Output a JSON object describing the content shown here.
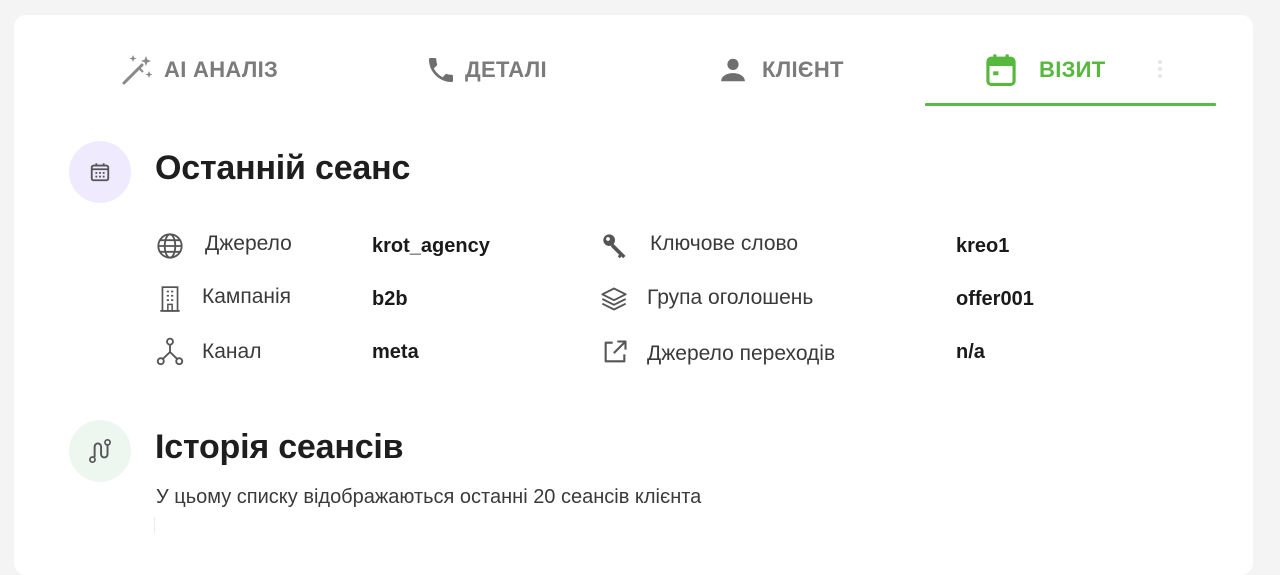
{
  "tabs": [
    {
      "label": "AI АНАЛІЗ",
      "icon": "magic-wand-icon",
      "active": false
    },
    {
      "label": "ДЕТАЛІ",
      "icon": "phone-icon",
      "active": false
    },
    {
      "label": "КЛІЄНТ",
      "icon": "person-icon",
      "active": false
    },
    {
      "label": "ВІЗИТ",
      "icon": "calendar-icon",
      "active": true
    }
  ],
  "colors": {
    "accent": "#56b83c",
    "tab_inactive": "#7b7b7b",
    "last_session_icon_bg": "#efeafd",
    "history_icon_bg": "#eef7ef"
  },
  "last_session": {
    "title": "Останній сеанс",
    "icon": "calendar-icon",
    "fields": {
      "source": {
        "label": "Джерело",
        "value": "krot_agency",
        "icon": "globe-icon"
      },
      "campaign": {
        "label": "Кампанія",
        "value": "b2b",
        "icon": "building-icon"
      },
      "channel": {
        "label": "Канал",
        "value": "meta",
        "icon": "network-icon"
      },
      "keyword": {
        "label": "Ключове слово",
        "value": "kreo1",
        "icon": "key-icon"
      },
      "ad_group": {
        "label": "Група оголошень",
        "value": "offer001",
        "icon": "layers-icon"
      },
      "referrer": {
        "label": "Джерело переходів",
        "value": "n/a",
        "icon": "external-link-icon"
      }
    }
  },
  "session_history": {
    "title": "Історія сеансів",
    "icon": "route-icon",
    "description": "У цьому списку відображаються останні 20 сеансів клієнта"
  }
}
